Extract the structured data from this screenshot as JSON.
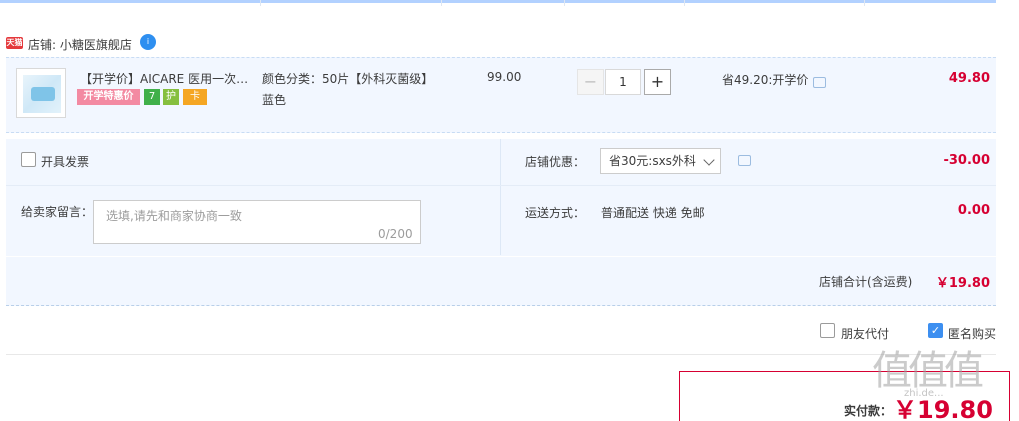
{
  "store": {
    "platform_badge": "天猫",
    "name": "店铺: 小糖医旗舰店"
  },
  "item": {
    "title": "【开学价】AICARE 医用一次性...",
    "promo_tag": "开学特惠价",
    "service_icons": [
      "7",
      "护",
      "卡"
    ],
    "sku_line1": "颜色分类：50片【外科灭菌级】",
    "sku_line2": "蓝色",
    "unit_price": "99.00",
    "quantity": "1",
    "minus_label": "−",
    "plus_label": "+",
    "saving": "省49.20:开学价",
    "total": "49.80"
  },
  "options": {
    "invoice_label": "开具发票",
    "store_coupon_label": "店铺优惠：",
    "store_coupon_value": "省30元:sxs外科",
    "coupon_amount": "-30.00",
    "message_label": "给卖家留言：",
    "message_placeholder": "选填,请先和商家协商一致",
    "message_count": "0/200",
    "shipping_label": "运送方式：",
    "shipping_value": "普通配送 快递 免邮",
    "shipping_fee": "0.00"
  },
  "subtotal": {
    "label": "店铺合计(含运费)",
    "value": "￥19.80"
  },
  "checkout": {
    "friend_pay_label": "朋友代付",
    "friend_pay_checked": false,
    "anonymous_label": "匿名购买",
    "anonymous_checked": true,
    "anonymous_check_glyph": "✓",
    "payable_label": "实付款：",
    "payable_value": "￥19.80"
  },
  "watermark": {
    "text": "值值值",
    "sub": "zhi.de..."
  },
  "colors": {
    "accent_red": "#d60032",
    "panel_bg": "#f2f7ff",
    "check_blue": "#3d8ff0"
  }
}
